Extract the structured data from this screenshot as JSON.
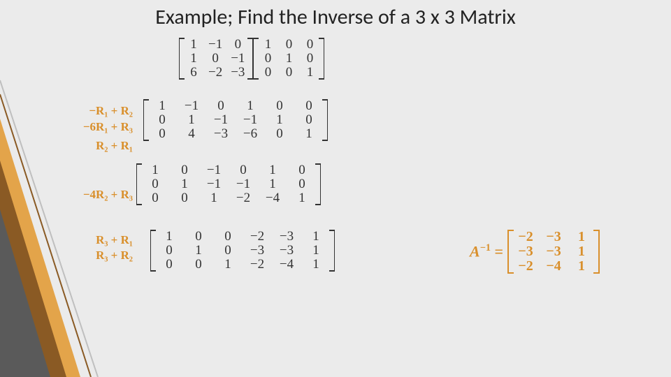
{
  "title": "Example; Find the Inverse of a 3 x 3 Matrix",
  "colors": {
    "accent": "#d98f2b",
    "bg": "#ebebeb"
  },
  "ops": {
    "o1": "−R₁ + R₂",
    "o2": "−6R₁ + R₃",
    "o3": "R₂ + R₁",
    "o4": "−4R₂ + R₃",
    "o5": "R₃ + R₁",
    "o6": "R₃ + R₂"
  },
  "mat1": {
    "A": [
      [
        "1",
        "1",
        "6"
      ],
      [
        "−1",
        "0",
        "−2"
      ],
      [
        "0",
        "−1",
        "−3"
      ]
    ],
    "I": [
      [
        "1",
        "0",
        "0"
      ],
      [
        "0",
        "1",
        "0"
      ],
      [
        "0",
        "0",
        "1"
      ]
    ]
  },
  "mat2": [
    [
      "1",
      "0",
      "0"
    ],
    [
      "−1",
      "1",
      "4"
    ],
    [
      "0",
      "−1",
      "−3"
    ],
    [
      "1",
      "−1",
      "−6"
    ],
    [
      "0",
      "1",
      "0"
    ],
    [
      "0",
      "0",
      "1"
    ]
  ],
  "mat3": [
    [
      "1",
      "0",
      "0"
    ],
    [
      "0",
      "1",
      "0"
    ],
    [
      "−1",
      "−1",
      "1"
    ],
    [
      "0",
      "−1",
      "−2"
    ],
    [
      "1",
      "1",
      "−4"
    ],
    [
      "0",
      "0",
      "1"
    ]
  ],
  "mat4": [
    [
      "1",
      "0",
      "0"
    ],
    [
      "0",
      "1",
      "0"
    ],
    [
      "0",
      "0",
      "1"
    ],
    [
      "−2",
      "−3",
      "−2"
    ],
    [
      "−3",
      "−3",
      "−4"
    ],
    [
      "1",
      "1",
      "1"
    ]
  ],
  "inv": {
    "label_html": "A⁻¹ =",
    "cols": [
      [
        "−2",
        "−3",
        "−2"
      ],
      [
        "−3",
        "−3",
        "−4"
      ],
      [
        "1",
        "1",
        "1"
      ]
    ]
  },
  "chart_data": {
    "type": "table",
    "title": "Gauss-Jordan inverse of a 3x3 matrix",
    "original_matrix_A": [
      [
        1,
        -1,
        0
      ],
      [
        1,
        0,
        -1
      ],
      [
        6,
        -2,
        -3
      ]
    ],
    "initial_augmented_AI": [
      [
        1,
        -1,
        0,
        1,
        0,
        0
      ],
      [
        1,
        0,
        -1,
        0,
        1,
        0
      ],
      [
        6,
        -2,
        -3,
        0,
        0,
        1
      ]
    ],
    "row_operations": [
      "-R1+R2",
      "-6R1+R3",
      "R2+R1",
      "-4R2+R3",
      "R3+R1",
      "R3+R2"
    ],
    "step_after_ops_1_2": [
      [
        1,
        -1,
        0,
        1,
        0,
        0
      ],
      [
        0,
        1,
        -1,
        -1,
        1,
        0
      ],
      [
        0,
        4,
        -3,
        -6,
        0,
        1
      ]
    ],
    "step_after_ops_3_4": [
      [
        1,
        0,
        -1,
        0,
        1,
        0
      ],
      [
        0,
        1,
        -1,
        -1,
        1,
        0
      ],
      [
        0,
        0,
        1,
        -2,
        -4,
        1
      ]
    ],
    "step_after_ops_5_6": [
      [
        1,
        0,
        0,
        -2,
        -3,
        1
      ],
      [
        0,
        1,
        0,
        -3,
        -3,
        1
      ],
      [
        0,
        0,
        1,
        -2,
        -4,
        1
      ]
    ],
    "A_inverse": [
      [
        -2,
        -3,
        1
      ],
      [
        -3,
        -3,
        1
      ],
      [
        -2,
        -4,
        1
      ]
    ]
  }
}
